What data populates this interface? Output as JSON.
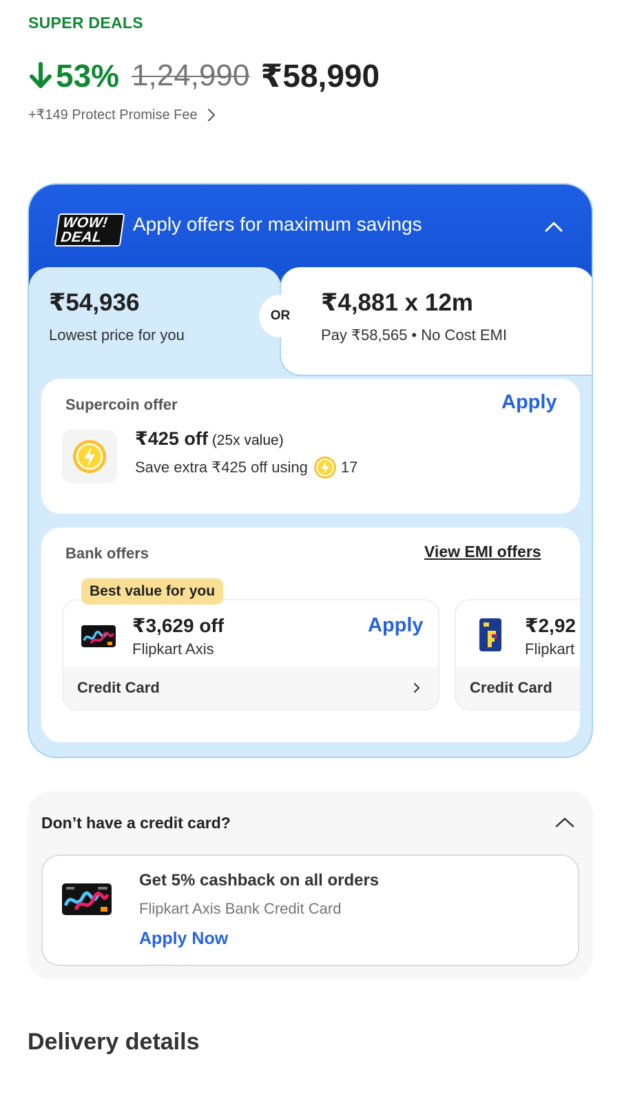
{
  "product": {
    "badge": "SUPER DEALS",
    "discount": "53%",
    "mrp": "1,24,990",
    "price": "₹58,990",
    "fee": "+₹149 Protect Promise Fee"
  },
  "offers": {
    "badge_line1": "WOW!",
    "badge_line2": "DEAL",
    "title": "Apply offers for maximum savings",
    "lowest_price": "₹54,936",
    "lowest_label": "Lowest price for you",
    "or": "OR",
    "emi_price": "₹4,881 x 12m",
    "emi_label": "Pay ₹58,565 • No Cost EMI",
    "supercoin": {
      "heading": "Supercoin offer",
      "apply": "Apply",
      "amount": "₹425 off",
      "value": "(25x value)",
      "desc": "Save extra ₹425 off using",
      "coins": "17"
    },
    "bank": {
      "heading": "Bank offers",
      "view_emi": "View EMI offers",
      "best_value": "Best value for you",
      "tiles": [
        {
          "amount": "₹3,629 off",
          "bank": "Flipkart Axis",
          "apply": "Apply",
          "type": "Credit Card"
        },
        {
          "amount": "₹2,92",
          "bank": "Flipkart",
          "type": "Credit Card"
        }
      ]
    }
  },
  "credit_card": {
    "title": "Don’t have a credit card?",
    "headline": "Get 5% cashback on all orders",
    "sub": "Flipkart Axis Bank Credit Card",
    "apply": "Apply Now"
  },
  "delivery": {
    "title": "Delivery details"
  },
  "colors": {
    "green": "#108934",
    "blue": "#2563e0",
    "header_blue": "#1452d4",
    "light_blue": "#d4ebfb"
  }
}
